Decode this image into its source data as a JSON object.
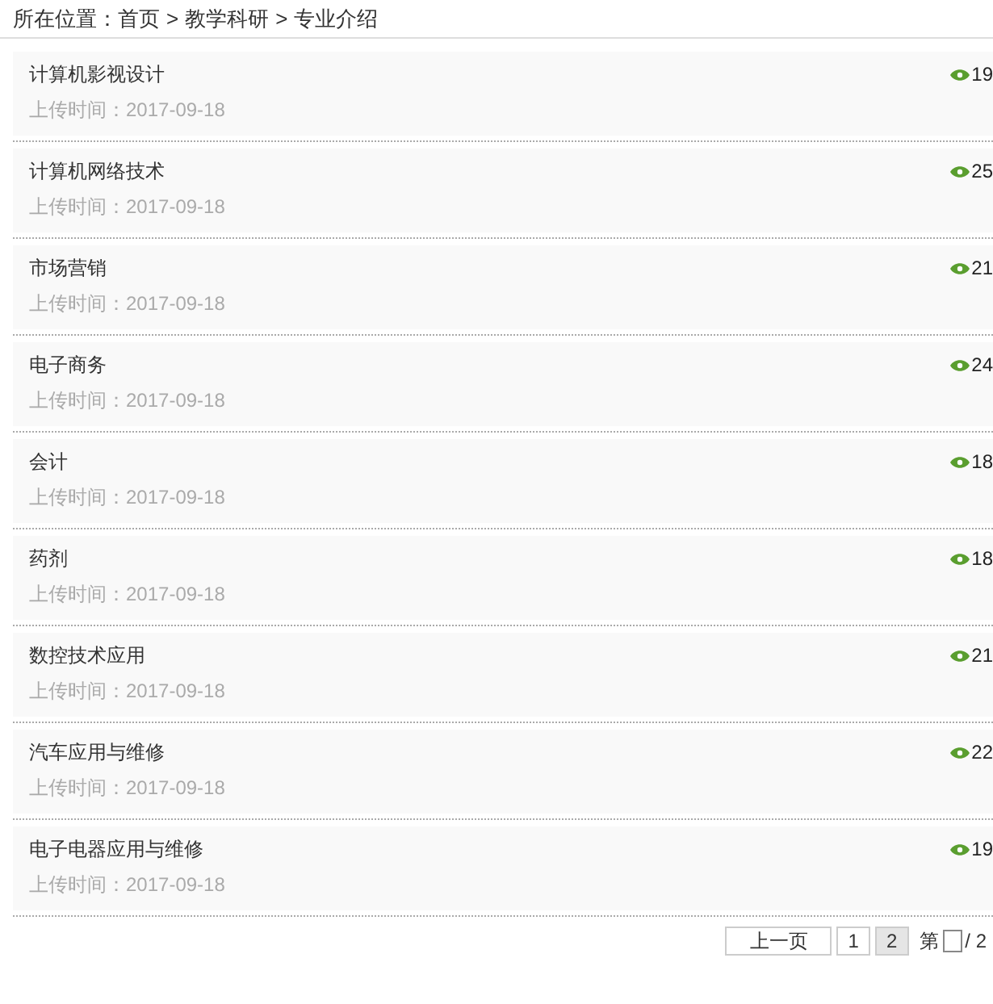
{
  "breadcrumb": {
    "label": "所在位置：",
    "separator": ">",
    "items": [
      "首页",
      "教学科研",
      "专业介绍"
    ]
  },
  "articles": [
    {
      "title": "计算机影视设计",
      "date": "上传时间：2017-09-18",
      "views": "19"
    },
    {
      "title": "计算机网络技术",
      "date": "上传时间：2017-09-18",
      "views": "25"
    },
    {
      "title": "市场营销",
      "date": "上传时间：2017-09-18",
      "views": "21"
    },
    {
      "title": "电子商务",
      "date": "上传时间：2017-09-18",
      "views": "24"
    },
    {
      "title": "会计",
      "date": "上传时间：2017-09-18",
      "views": "18"
    },
    {
      "title": "药剂",
      "date": "上传时间：2017-09-18",
      "views": "18"
    },
    {
      "title": "数控技术应用",
      "date": "上传时间：2017-09-18",
      "views": "21"
    },
    {
      "title": "汽车应用与维修",
      "date": "上传时间：2017-09-18",
      "views": "22"
    },
    {
      "title": "电子电器应用与维修",
      "date": "上传时间：2017-09-18",
      "views": "19"
    }
  ],
  "pagination": {
    "prev": "上一页",
    "pages": [
      {
        "label": "1",
        "selected": false
      },
      {
        "label": "2",
        "selected": true
      }
    ],
    "page_input_label": "第",
    "total": "/ 2"
  }
}
